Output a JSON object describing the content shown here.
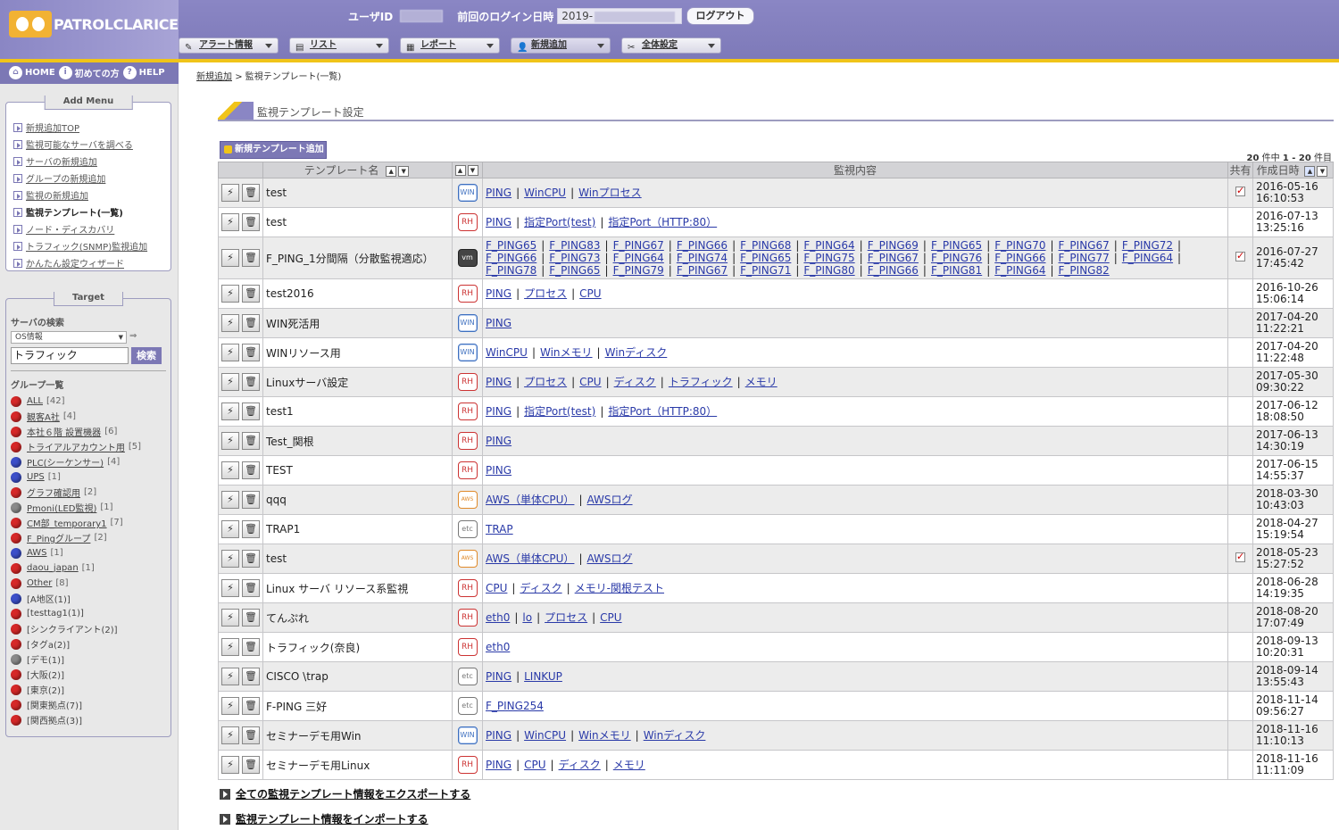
{
  "header": {
    "logo_text": "PATROLCLARICE",
    "user_id_label": "ユーザID",
    "last_login_label": "前回のログイン日時",
    "last_login_value": "2019-",
    "logout_label": "ログアウト",
    "nav": [
      {
        "label": "アラート情報",
        "icon": "wrench-icon"
      },
      {
        "label": "リスト",
        "icon": "list-icon"
      },
      {
        "label": "レポート",
        "icon": "document-icon"
      },
      {
        "label": "新規追加",
        "icon": "user-add-icon"
      },
      {
        "label": "全体設定",
        "icon": "tools-icon"
      }
    ]
  },
  "toplinks": [
    {
      "label": "HOME",
      "icon": "home-icon",
      "glyph": "⌂"
    },
    {
      "label": "初めての方",
      "icon": "info-icon",
      "glyph": "i"
    },
    {
      "label": "HELP",
      "icon": "help-icon",
      "glyph": "?"
    }
  ],
  "add_menu": {
    "title": "Add Menu",
    "items": [
      {
        "label": "新規追加TOP",
        "current": false
      },
      {
        "label": "監視可能なサーバを調べる",
        "current": false
      },
      {
        "label": "サーバの新規追加",
        "current": false
      },
      {
        "label": "グループの新規追加",
        "current": false
      },
      {
        "label": "監視の新規追加",
        "current": false
      },
      {
        "label": "監視テンプレート(一覧)",
        "current": true
      },
      {
        "label": "ノード・ディスカバリ",
        "current": false
      },
      {
        "label": "トラフィック(SNMP)監視追加",
        "current": false
      },
      {
        "label": "かんたん設定ウィザード",
        "current": false
      }
    ]
  },
  "target": {
    "title": "Target",
    "server_search_label": "サーバの検索",
    "os_select_value": "OS情報",
    "search_value": "トラフィック",
    "search_button": "検索",
    "group_list_label": "グループ一覧",
    "groups": [
      {
        "name": "ALL",
        "count": "[42]",
        "color": "#d62828",
        "link": true
      },
      {
        "name": "観客A社",
        "count": "[4]",
        "color": "#d62828",
        "link": true
      },
      {
        "name": "本社６階 設置機器",
        "count": "[6]",
        "color": "#d62828",
        "link": true
      },
      {
        "name": "トライアルアカウント用",
        "count": "[5]",
        "color": "#d62828",
        "link": true
      },
      {
        "name": "PLC(シーケンサー)",
        "count": "[4]",
        "color": "#3c4fc9",
        "link": true
      },
      {
        "name": "UPS",
        "count": "[1]",
        "color": "#3c4fc9",
        "link": true
      },
      {
        "name": "グラフ確認用",
        "count": "[2]",
        "color": "#d62828",
        "link": true
      },
      {
        "name": "Pmoni(LED監視)",
        "count": "[1]",
        "color": "#8a8a8a",
        "link": true
      },
      {
        "name": "CM部_temporary1",
        "count": "[7]",
        "color": "#d62828",
        "link": true
      },
      {
        "name": "F_Pingグループ",
        "count": "[2]",
        "color": "#d62828",
        "link": true
      },
      {
        "name": "AWS",
        "count": "[1]",
        "color": "#3c4fc9",
        "link": true
      },
      {
        "name": "daou_japan",
        "count": "[1]",
        "color": "#d62828",
        "link": true
      },
      {
        "name": "Other",
        "count": "[8]",
        "color": "#d62828",
        "link": true
      },
      {
        "name": "[A地区(1)]",
        "count": "",
        "color": "#3c4fc9",
        "link": false
      },
      {
        "name": "[testtag1(1)]",
        "count": "",
        "color": "#d62828",
        "link": false
      },
      {
        "name": "[シンクライアント(2)]",
        "count": "",
        "color": "#d62828",
        "link": false
      },
      {
        "name": "[タグa(2)]",
        "count": "",
        "color": "#d62828",
        "link": false
      },
      {
        "name": "[デモ(1)]",
        "count": "",
        "color": "#8a8a8a",
        "link": false
      },
      {
        "name": "[大阪(2)]",
        "count": "",
        "color": "#d62828",
        "link": false
      },
      {
        "name": "[東京(2)]",
        "count": "",
        "color": "#d62828",
        "link": false
      },
      {
        "name": "[関東拠点(7)]",
        "count": "",
        "color": "#d62828",
        "link": false
      },
      {
        "name": "[関西拠点(3)]",
        "count": "",
        "color": "#d62828",
        "link": false
      }
    ]
  },
  "breadcrumb": {
    "parent": "新規追加",
    "separator": ">",
    "current": "監視テンプレート(一覧)"
  },
  "section_title": "監視テンプレート設定",
  "new_template_button": "新規テンプレート追加",
  "count": {
    "total": "20",
    "unit1": "件中",
    "range": "1 - 20",
    "unit2": "件目"
  },
  "table": {
    "headers": {
      "name": "テンプレート名",
      "monitor": "監視内容",
      "shared": "共有",
      "created": "作成日時"
    },
    "rows": [
      {
        "name": "test",
        "os": "WIN",
        "monitors": [
          "PING",
          "WinCPU",
          "Winプロセス"
        ],
        "shared": true,
        "date": "2016-05-16",
        "time": "16:10:53"
      },
      {
        "name": "test",
        "os": "RH",
        "monitors": [
          "PING",
          "指定Port(test)",
          "指定Port（HTTP:80）"
        ],
        "shared": false,
        "date": "2016-07-13",
        "time": "13:25:16"
      },
      {
        "name": "F_PING_1分間隔（分散監視適応）",
        "os": "vm",
        "monitors": [
          "F_PING65",
          "F_PING83",
          "F_PING67",
          "F_PING66",
          "F_PING68",
          "F_PING64",
          "F_PING69",
          "F_PING65",
          "F_PING70",
          "F_PING67",
          "F_PING72",
          "F_PING66",
          "F_PING73",
          "F_PING64",
          "F_PING74",
          "F_PING65",
          "F_PING75",
          "F_PING67",
          "F_PING76",
          "F_PING66",
          "F_PING77",
          "F_PING64",
          "F_PING78",
          "F_PING65",
          "F_PING79",
          "F_PING67",
          "F_PING71",
          "F_PING80",
          "F_PING66",
          "F_PING81",
          "F_PING64",
          "F_PING82"
        ],
        "shared": true,
        "date": "2016-07-27",
        "time": "17:45:42",
        "tall": true
      },
      {
        "name": "test2016",
        "os": "RH",
        "monitors": [
          "PING",
          "プロセス",
          "CPU"
        ],
        "shared": false,
        "date": "2016-10-26",
        "time": "15:06:14"
      },
      {
        "name": "WIN死活用",
        "os": "WIN",
        "monitors": [
          "PING"
        ],
        "shared": false,
        "date": "2017-04-20",
        "time": "11:22:21"
      },
      {
        "name": "WINリソース用",
        "os": "WIN",
        "monitors": [
          "WinCPU",
          "Winメモリ",
          "Winディスク"
        ],
        "shared": false,
        "date": "2017-04-20",
        "time": "11:22:48"
      },
      {
        "name": "Linuxサーバ設定",
        "os": "RH",
        "monitors": [
          "PING",
          "プロセス",
          "CPU",
          "ディスク",
          "トラフィック",
          "メモリ"
        ],
        "shared": false,
        "date": "2017-05-30",
        "time": "09:30:22"
      },
      {
        "name": "test1",
        "os": "RH",
        "monitors": [
          "PING",
          "指定Port(test)",
          "指定Port（HTTP:80）"
        ],
        "shared": false,
        "date": "2017-06-12",
        "time": "18:08:50"
      },
      {
        "name": "Test_関根",
        "os": "RH",
        "monitors": [
          "PING"
        ],
        "shared": false,
        "date": "2017-06-13",
        "time": "14:30:19"
      },
      {
        "name": "TEST",
        "os": "RH",
        "monitors": [
          "PING"
        ],
        "shared": false,
        "date": "2017-06-15",
        "time": "14:55:37"
      },
      {
        "name": "qqq",
        "os": "AWS",
        "monitors": [
          "AWS（単体CPU）",
          "AWSログ"
        ],
        "shared": false,
        "date": "2018-03-30",
        "time": "10:43:03"
      },
      {
        "name": "TRAP1",
        "os": "etc",
        "monitors": [
          "TRAP"
        ],
        "shared": false,
        "date": "2018-04-27",
        "time": "15:19:54"
      },
      {
        "name": "test",
        "os": "AWS",
        "monitors": [
          "AWS（単体CPU）",
          "AWSログ"
        ],
        "shared": true,
        "date": "2018-05-23",
        "time": "15:27:52"
      },
      {
        "name": "Linux サーバ リソース系監視",
        "os": "RH",
        "monitors": [
          "CPU",
          "ディスク",
          "メモリ-関根テスト"
        ],
        "shared": false,
        "date": "2018-06-28",
        "time": "14:19:35"
      },
      {
        "name": "てんぷれ",
        "os": "RH",
        "monitors": [
          "eth0",
          "lo",
          "プロセス",
          "CPU"
        ],
        "shared": false,
        "date": "2018-08-20",
        "time": "17:07:49"
      },
      {
        "name": "トラフィック(奈良)",
        "os": "RH",
        "monitors": [
          "eth0"
        ],
        "shared": false,
        "date": "2018-09-13",
        "time": "10:20:31"
      },
      {
        "name": "CISCO \\trap",
        "os": "etc",
        "monitors": [
          "PING",
          "LINKUP"
        ],
        "shared": false,
        "date": "2018-09-14",
        "time": "13:55:43"
      },
      {
        "name": "F-PING 三好",
        "os": "etc",
        "monitors": [
          "F_PING254"
        ],
        "shared": false,
        "date": "2018-11-14",
        "time": "09:56:27"
      },
      {
        "name": "セミナーデモ用Win",
        "os": "WIN",
        "monitors": [
          "PING",
          "WinCPU",
          "Winメモリ",
          "Winディスク"
        ],
        "shared": false,
        "date": "2018-11-16",
        "time": "11:10:13"
      },
      {
        "name": "セミナーデモ用Linux",
        "os": "RH",
        "monitors": [
          "PING",
          "CPU",
          "ディスク",
          "メモリ"
        ],
        "shared": false,
        "date": "2018-11-16",
        "time": "11:11:09"
      }
    ]
  },
  "bottom_links": [
    "全ての監視テンプレート情報をエクスポートする",
    "監視テンプレート情報をインポートする"
  ]
}
